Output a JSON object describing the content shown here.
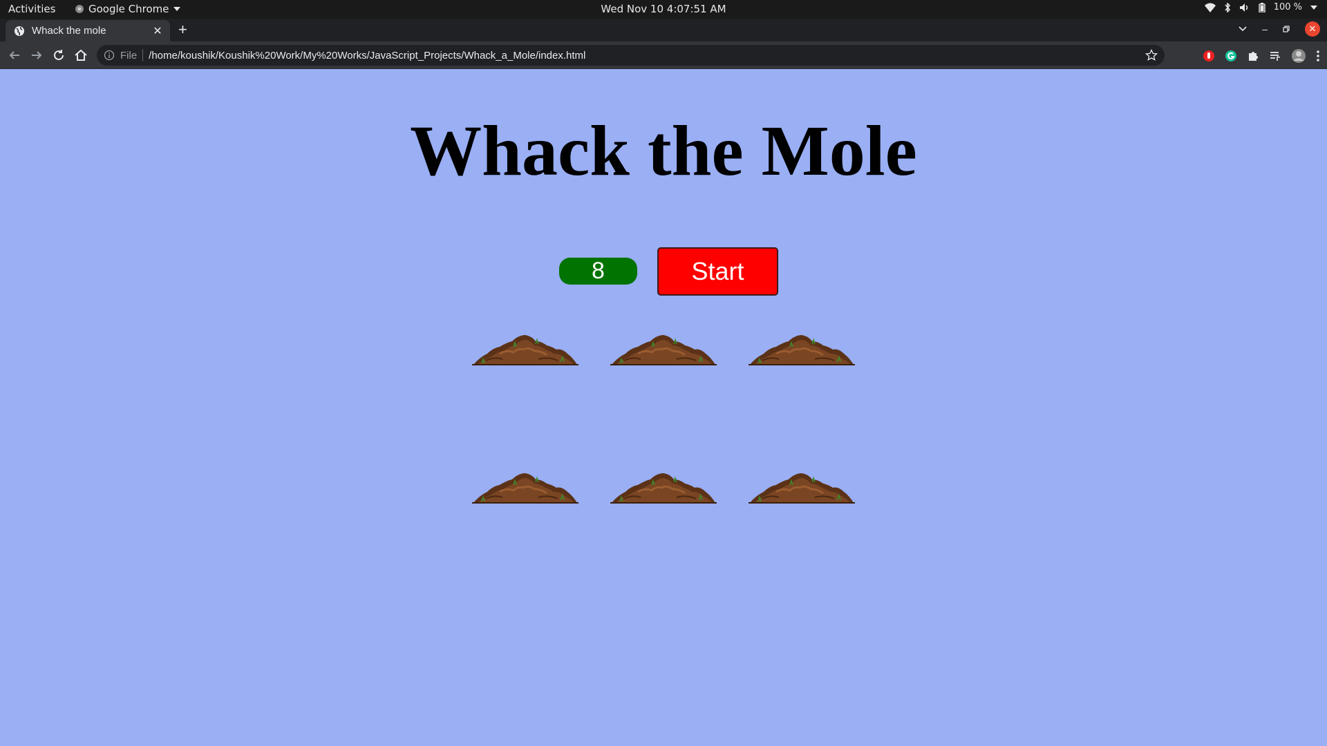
{
  "os_bar": {
    "activities_label": "Activities",
    "app_name": "Google Chrome",
    "datetime": "Wed Nov 10  4:07:51 AM",
    "battery": "100 %"
  },
  "browser": {
    "tab_title": "Whack the mole",
    "url_scheme": "File",
    "url": "/home/koushik/Koushik%20Work/My%20Works/JavaScript_Projects/Whack_a_Mole/index.html"
  },
  "game": {
    "title": "Whack the Mole",
    "score": "8",
    "start_label": "Start",
    "holes": [
      "mole-hole",
      "mole-hole",
      "mole-hole",
      "mole-hole",
      "mole-hole",
      "mole-hole"
    ]
  },
  "colors": {
    "page_background": "#9aaff4",
    "score_background": "#007300",
    "start_background": "#ff0000"
  }
}
